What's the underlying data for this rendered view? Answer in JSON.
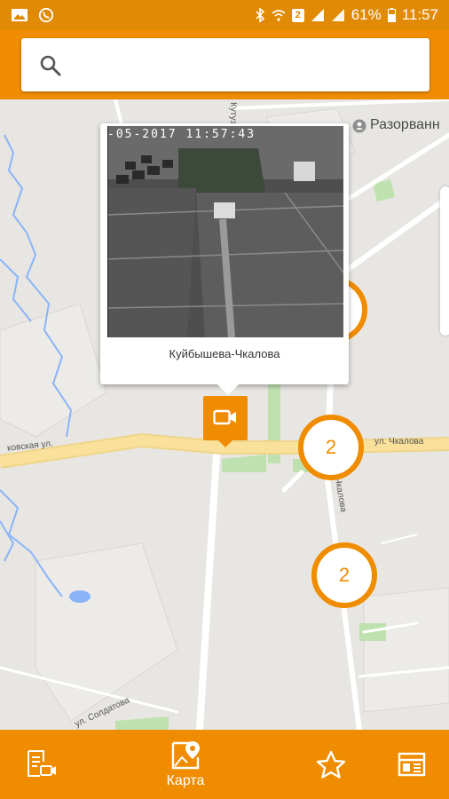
{
  "status_bar": {
    "battery": "61%",
    "time": "11:57",
    "notification_count": "2",
    "icons": [
      "image-icon",
      "viber-icon",
      "bluetooth-icon",
      "wifi-icon",
      "notification-badge",
      "signal-icon",
      "signal-icon",
      "battery-icon"
    ]
  },
  "search": {
    "placeholder": "",
    "value": ""
  },
  "map": {
    "poi": {
      "label": "Разорванн",
      "icon": "place-icon"
    },
    "road_labels": {
      "chkalova": "ул. Чкалова",
      "moskovskaya": "ковская ул.",
      "soldatova": "ул. Солдатова",
      "kutuzova_vertical": "Кутуз",
      "chkalova_vertical": "Чкалова"
    },
    "info_window": {
      "timestamp": "-05-2017  11:57:43",
      "caption": "Куйбышева-Чкалова"
    },
    "clusters": [
      {
        "count": "2"
      },
      {
        "count": "2"
      }
    ]
  },
  "bottom_nav": {
    "items": [
      {
        "name": "camera-list",
        "label": ""
      },
      {
        "name": "map",
        "label": "Карта",
        "active": true
      },
      {
        "name": "favorites",
        "label": ""
      },
      {
        "name": "news",
        "label": ""
      }
    ]
  },
  "colors": {
    "accent": "#f08c00",
    "status_bar": "#e08a06",
    "map_bg": "#e8e6e2",
    "road_major": "#f9e19c",
    "park": "#bfe1b0",
    "water": "#8ab4f8"
  }
}
